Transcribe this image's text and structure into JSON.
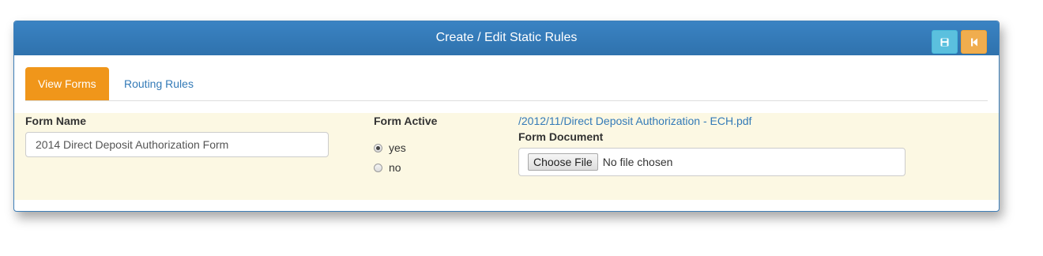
{
  "panel": {
    "title": "Create / Edit Static Rules",
    "save_icon": "floppy-disk-icon",
    "back_icon": "step-backward-icon",
    "save_color": "#5bc0de",
    "back_color": "#f0ad4e"
  },
  "tabs": [
    {
      "label": "View Forms",
      "active": true
    },
    {
      "label": "Routing Rules",
      "active": false
    }
  ],
  "form": {
    "form_name_label": "Form Name",
    "form_name_value": "2014 Direct Deposit Authorization Form",
    "form_active_label": "Form Active",
    "options": [
      {
        "label": "yes",
        "checked": true
      },
      {
        "label": "no",
        "checked": false
      }
    ],
    "document_link": "/2012/11/Direct Deposit Authorization - ECH.pdf",
    "form_document_label": "Form Document",
    "choose_file_label": "Choose File",
    "file_status": "No file chosen"
  },
  "colors": {
    "header": "#337ab7",
    "active_tab": "#f0961a",
    "form_row_bg": "#fcf8e3",
    "link": "#337ab7"
  }
}
